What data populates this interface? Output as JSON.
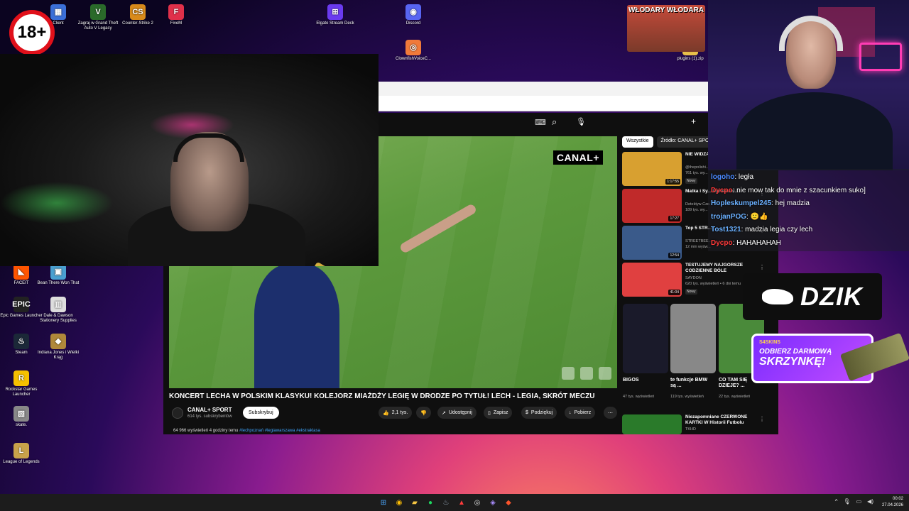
{
  "badge": "18+",
  "desktop_icons": [
    {
      "label": "Client",
      "glyph": "▦",
      "color": "#3b6fd8"
    },
    {
      "label": "Zagraj w Grand Theft Auto V Legacy",
      "glyph": "V",
      "color": "#2a6a2a"
    },
    {
      "label": "Counter-Strike 2",
      "glyph": "CS",
      "color": "#d88a1a"
    },
    {
      "label": "FiveM",
      "glyph": "F",
      "color": "#e0304a"
    },
    {
      "label": "Elgato Stream Deck",
      "glyph": "⊞",
      "color": "#6a3af0"
    },
    {
      "label": "Discord",
      "glyph": "◉",
      "color": "#5865f2"
    },
    {
      "label": "plugins (1).zip",
      "glyph": "▤",
      "color": "#e8c04a"
    },
    {
      "label": "ClownfishVoiceC...",
      "glyph": "◎",
      "color": "#f07a3a"
    },
    {
      "label": "FACEIT",
      "glyph": "◣",
      "color": "#ff5500"
    },
    {
      "label": "Bean There Won That",
      "glyph": "▣",
      "color": "#4aa0d0"
    },
    {
      "label": "Epic Games Launcher",
      "glyph": "EPIC",
      "color": "#222"
    },
    {
      "label": "Dale & Dawson Stationery Supplies",
      "glyph": "▥",
      "color": "#ddd"
    },
    {
      "label": "Steam",
      "glyph": "♨",
      "color": "#1b2838"
    },
    {
      "label": "Indiana Jones i Wielki Krąg",
      "glyph": "◆",
      "color": "#b0883a"
    },
    {
      "label": "Rockstar Games Launcher",
      "glyph": "R",
      "color": "#f5c000"
    },
    {
      "label": "skate.",
      "glyph": "▧",
      "color": "#888"
    },
    {
      "label": "League of Legends",
      "glyph": "L",
      "color": "#c8a24a"
    }
  ],
  "video": {
    "logo": "CANAL+",
    "title": "KONCERT LECHA W POLSKIM KLASYKU! KOLEJORZ MIAŻDŻY LEGIĘ W DRODZE PO TYTUŁ! LECH - LEGIA, SKRÓT MECZU",
    "channel": "CANAL+ SPORT",
    "subscribers": "614 tys. subskrybentów",
    "subscribe": "Subskrybuj",
    "likes": "2,1 tys.",
    "share": "Udostępnij",
    "save": "Zapisz",
    "thanks": "Podziękuj",
    "download": "Pobierz",
    "views_time": "64 966 wyświetleń  4 godziny temu",
    "hashtags": "#lechpoznań #legiawarszawa #ekstraklasa"
  },
  "sidebar": {
    "chips": [
      "Wszystkie",
      "Źródło: CANAL+ SPO"
    ],
    "recs": [
      {
        "title": "NIE WIDZA CASTING...",
        "channel": "@thepolishi...",
        "meta": "761 tys. wy...",
        "badge": "Nowy",
        "duration": "1:17:55",
        "color": "#d8a030"
      },
      {
        "title": "Matka i Sy... Uprawiani...",
        "channel": "Detektyw Cze...",
        "meta": "189 tys. wy...",
        "badge": "",
        "duration": "17:27",
        "color": "#c02a2a"
      },
      {
        "title": "Top 5 STR...",
        "channel": "STREETBEE...",
        "meta": "12 min wyśw...",
        "badge": "",
        "duration": "12:54",
        "color": "#3a5a8a"
      },
      {
        "title": "TESTUJEMY NAJGORSZE CODZIENNE BÓLE",
        "channel": "SAYDON",
        "meta": "620 tys. wyświetleń • 6 dni temu",
        "badge": "Nowy",
        "duration": "41:04",
        "color": "#e04040"
      }
    ],
    "shorts": [
      {
        "title": "BIGOS",
        "meta": "47 tys. wyświetleń",
        "color": "#1a1a2a"
      },
      {
        "title": "te funkcje BMW są ...",
        "meta": "119 tys. wyświetleń",
        "color": "#888"
      },
      {
        "title": "CO TAM SIĘ DZIEJE? ...",
        "meta": "22 tys. wyświetleń",
        "color": "#4a8a3a"
      }
    ],
    "last": {
      "title": "Niezapomniane CZERWONE KARTKI W Historii Futbolu",
      "channel": "TKHD",
      "color": "#2a7a2a"
    }
  },
  "chat": [
    {
      "user": "logoho",
      "msg": ": legła",
      "color": "#4a8aff"
    },
    {
      "user": "Dycpo",
      "msg": ": nie mow tak do mnie z szacunkiem suko]",
      "color": "#ff3a3a"
    },
    {
      "user": "Hopleskumpel245",
      "msg": ": hej madzia",
      "color": "#6ab0ff"
    },
    {
      "user": "trojanPOG",
      "msg": ": 🙂👍",
      "color": "#6ab0ff"
    },
    {
      "user": "Tost1321",
      "msg": ": madzia legia czy lech",
      "color": "#6ab0ff"
    },
    {
      "user": "Dycpo",
      "msg": ": HAHAHAHAH",
      "color": "#ff3a3a"
    }
  ],
  "overlay": {
    "dzik": "DZIK",
    "skins_brand": "S4SKINS",
    "skins_cta1": "ODBIERZ DARMOWĄ",
    "skins_cta2": "SKRZYNKĘ!",
    "wlodary": "WŁODARY WŁODARA"
  },
  "taskbar": {
    "time": "00:02",
    "date": "27.04.2026"
  }
}
